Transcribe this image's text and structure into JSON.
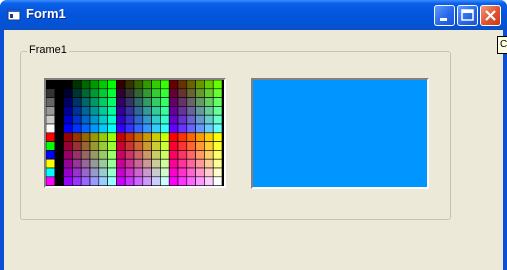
{
  "window": {
    "title": "Form1"
  },
  "frame": {
    "label": "Frame1"
  },
  "preview": {
    "color": "#0095ff"
  },
  "tooltip": {
    "text": "Co"
  },
  "titlebar_buttons": [
    {
      "name": "minimize",
      "icon": "minimize-icon"
    },
    {
      "name": "maximize",
      "icon": "maximize-icon"
    },
    {
      "name": "close",
      "icon": "close-icon"
    }
  ],
  "palette": {
    "first_column_colors": [
      "#000000",
      "#333333",
      "#666666",
      "#999999",
      "#cccccc",
      "#ffffff",
      "#ff0000",
      "#00ff00",
      "#0000ff",
      "#ffff00",
      "#00ffff",
      "#ff00ff"
    ]
  }
}
